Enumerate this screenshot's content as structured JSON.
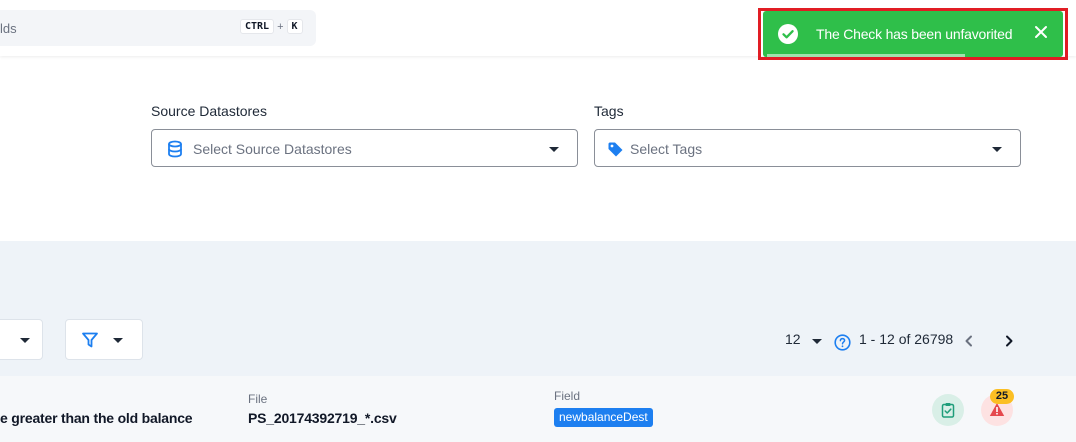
{
  "topbar": {
    "search_placeholder": "lds",
    "shortcut": [
      "CTRL",
      "+",
      "K"
    ]
  },
  "toast": {
    "message": "The Check has been unfavorited",
    "icon": "check-circle-icon",
    "close_icon": "close-icon",
    "background": "#2fbf4a",
    "highlight_border": "#e11d24"
  },
  "filters": {
    "source_datastores": {
      "label": "Source Datastores",
      "placeholder": "Select Source Datastores",
      "icon": "database-icon"
    },
    "tags": {
      "label": "Tags",
      "placeholder": "Select Tags",
      "icon": "tag-icon"
    }
  },
  "toolbar": {
    "filter_icon": "filter-icon",
    "page_size": "12",
    "range": "1 - 12 of 26798",
    "help_icon": "help-circle-icon"
  },
  "row": {
    "description": "e greater than the old balance",
    "file_label": "File",
    "file_value": "PS_20174392719_*.csv",
    "field_label": "Field",
    "field_value": "newbalanceDest",
    "anomaly_count": "25",
    "accent": "#1d7ff0"
  }
}
